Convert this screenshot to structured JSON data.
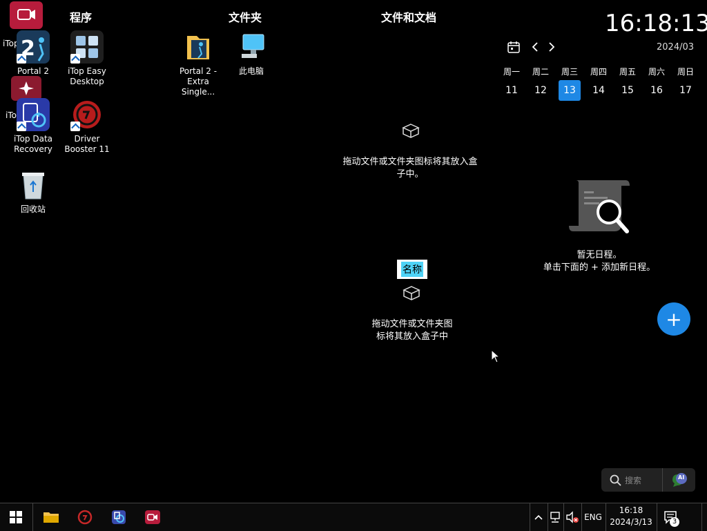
{
  "sections": {
    "programs": "程序",
    "folders": "文件夹",
    "files_docs": "文件和文档"
  },
  "desktop_icons": {
    "portal2": "Portal 2",
    "itop_easy": "iTop Easy Desktop",
    "itop_data": "iTop Data Recovery",
    "driver_booster": "Driver Booster 11",
    "recycle_bin": "回收站",
    "partial_top": "iTop Re",
    "partial_mid": "iTo",
    "portal2_folder": "Portal 2 - Extra Single...",
    "this_pc": "此电脑"
  },
  "box_hints": {
    "box1": "拖动文件或文件夹图标将其放入盒子中。",
    "box2_label": "名称",
    "box2": "拖动文件或文件夹图标将其放入盒子中"
  },
  "clock": {
    "time": "16:18:13",
    "month": "2024/03",
    "weekdays": [
      "周一",
      "周二",
      "周三",
      "周四",
      "周五",
      "周六",
      "周日"
    ],
    "days": [
      "11",
      "12",
      "13",
      "14",
      "15",
      "16",
      "17"
    ]
  },
  "schedule": {
    "empty_line1": "暂无日程。",
    "empty_line2": "单击下面的 + 添加新日程。",
    "add_symbol": "+"
  },
  "search": {
    "placeholder": "搜索",
    "ai_label": "AI"
  },
  "taskbar": {
    "language": "ENG",
    "time": "16:18",
    "date": "2024/3/13",
    "notification_count": "3"
  }
}
